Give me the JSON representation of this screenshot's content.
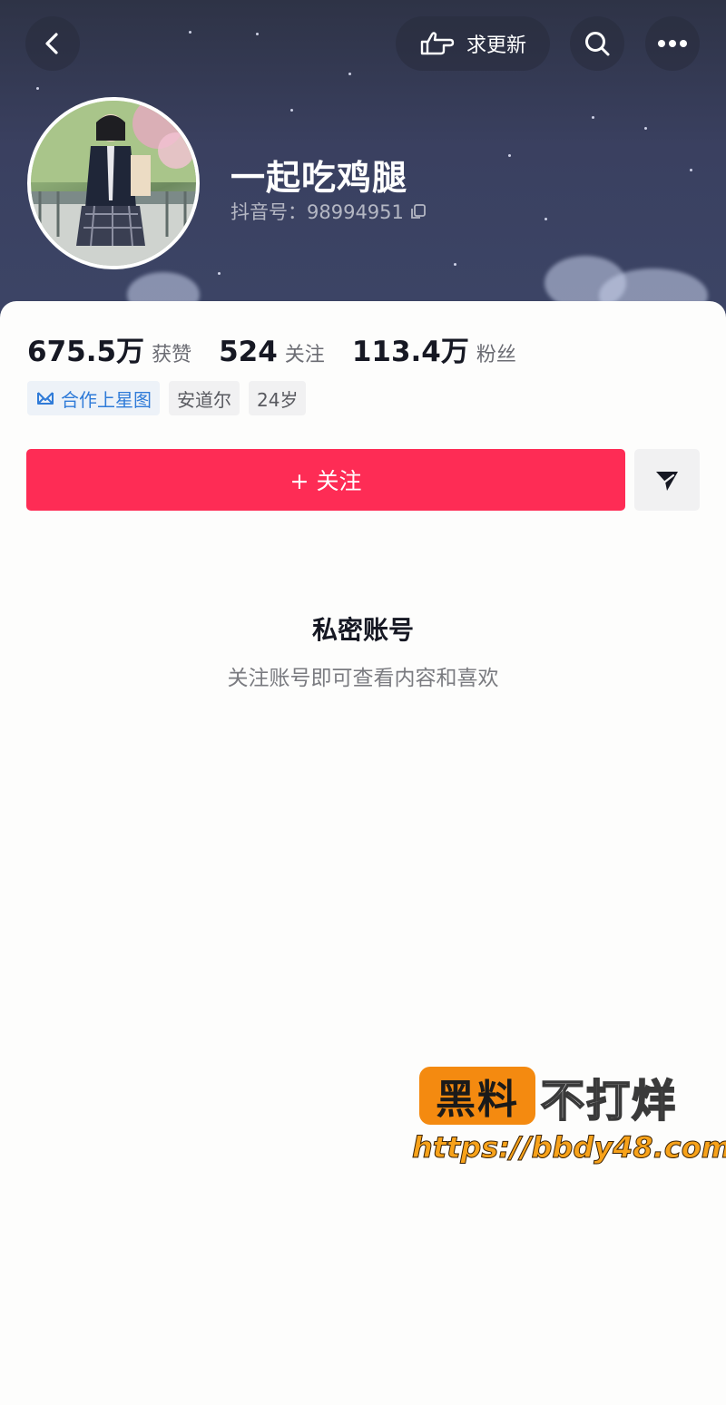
{
  "header": {
    "request_update_label": "求更新",
    "back_icon": "chevron-left-icon",
    "request_icon": "pointing-hand-icon",
    "search_icon": "search-icon",
    "more_icon": "more-dots-icon"
  },
  "profile": {
    "nickname": "一起吃鸡腿",
    "douyin_id_label": "抖音号：98994951",
    "stats": [
      {
        "value": "675.5万",
        "label": "获赞"
      },
      {
        "value": "524",
        "label": "关注"
      },
      {
        "value": "113.4万",
        "label": "粉丝"
      }
    ],
    "tags": [
      {
        "label": "合作上星图"
      },
      {
        "label": "安道尔"
      },
      {
        "label": "24岁"
      }
    ]
  },
  "actions": {
    "follow_label": "+ 关注"
  },
  "privacy": {
    "title": "私密账号",
    "subtitle": "关注账号即可查看内容和喜欢"
  },
  "watermark": {
    "brand_box": "黑料",
    "brand_text": "不打烊",
    "url": "https://bbdy48.com"
  },
  "colors": {
    "accent": "#fe2c55",
    "banner": "#3a4060",
    "watermark_orange": "#f48a10"
  }
}
